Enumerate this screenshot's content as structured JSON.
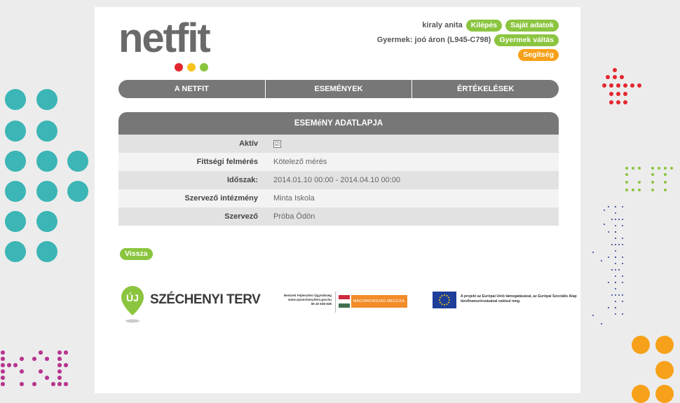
{
  "header": {
    "logo_text": "netfit",
    "user_name": "kiraly anita",
    "logout_label": "Kilépés",
    "own_data_label": "Saját adatok",
    "child_info": "Gyermek: joó áron (L945-C798)",
    "switch_child_label": "Gyermek váltás",
    "help_label": "Segítség"
  },
  "nav": {
    "items": [
      "A NETFIT",
      "ESEMÉNYEK",
      "ÉRTÉKELÉSEK"
    ]
  },
  "event_sheet": {
    "title": "ESEMéNY ADATLAPJA",
    "rows": [
      {
        "label": "Aktív",
        "value": "☑"
      },
      {
        "label": "Fittségi felmérés",
        "value": "Kötelező mérés"
      },
      {
        "label": "Időszak:",
        "value": "2014.01.10 00:00 - 2014.04.10 00:00"
      },
      {
        "label": "Szervező intézmény",
        "value": "Minta Iskola"
      },
      {
        "label": "Szervező",
        "value": "Próba Ödön"
      }
    ]
  },
  "back_label": "Vissza",
  "footer": {
    "szechenyi_pin": "ÚJ",
    "szechenyi_text": "SZÉCHENYI TERV",
    "nfu_line1": "Nemzeti Fejlesztési Ügynökség",
    "nfu_line2": "www.ujszechenyiterv.gov.hu",
    "nfu_line3": "06 40 638 638",
    "mo_banner": "MAGYARORSZÁG MEGÚJUL",
    "eu_text": "A projekt az Európai Unió támogatásával, az Európai Szociális Alap társfinanszírozásával valósul meg."
  },
  "colors": {
    "green": "#8bc53f",
    "orange": "#f7a11a",
    "nav_gray": "#777777",
    "teal": "#3bb5b5",
    "red": "#e3262e",
    "magenta": "#b7348f",
    "navy": "#2e3c8f"
  }
}
